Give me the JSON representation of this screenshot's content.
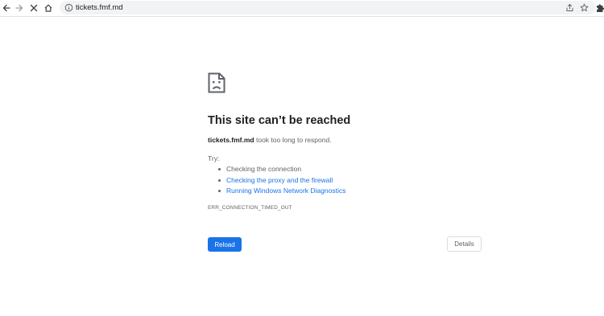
{
  "browser": {
    "url": "tickets.fmf.md",
    "icons": {
      "back": "back-arrow-icon",
      "forward": "forward-arrow-icon",
      "stop": "close-icon",
      "home": "home-icon",
      "site_info": "info-icon",
      "share": "share-icon",
      "bookmark": "star-icon",
      "extensions": "puzzle-icon"
    }
  },
  "error_page": {
    "icon": "sad-page-icon",
    "title": "This site can’t be reached",
    "host": "tickets.fmf.md",
    "summary_suffix": " took too long to respond.",
    "try_label": "Try:",
    "suggestions": [
      {
        "text": "Checking the connection",
        "is_link": false
      },
      {
        "text": "Checking the proxy and the firewall",
        "is_link": true
      },
      {
        "text": "Running Windows Network Diagnostics",
        "is_link": true
      }
    ],
    "error_code": "ERR_CONNECTION_TIMED_OUT",
    "reload_label": "Reload",
    "details_label": "Details"
  },
  "colors": {
    "accent": "#1a73e8",
    "text_primary": "#202124",
    "text_secondary": "#5f6368"
  }
}
